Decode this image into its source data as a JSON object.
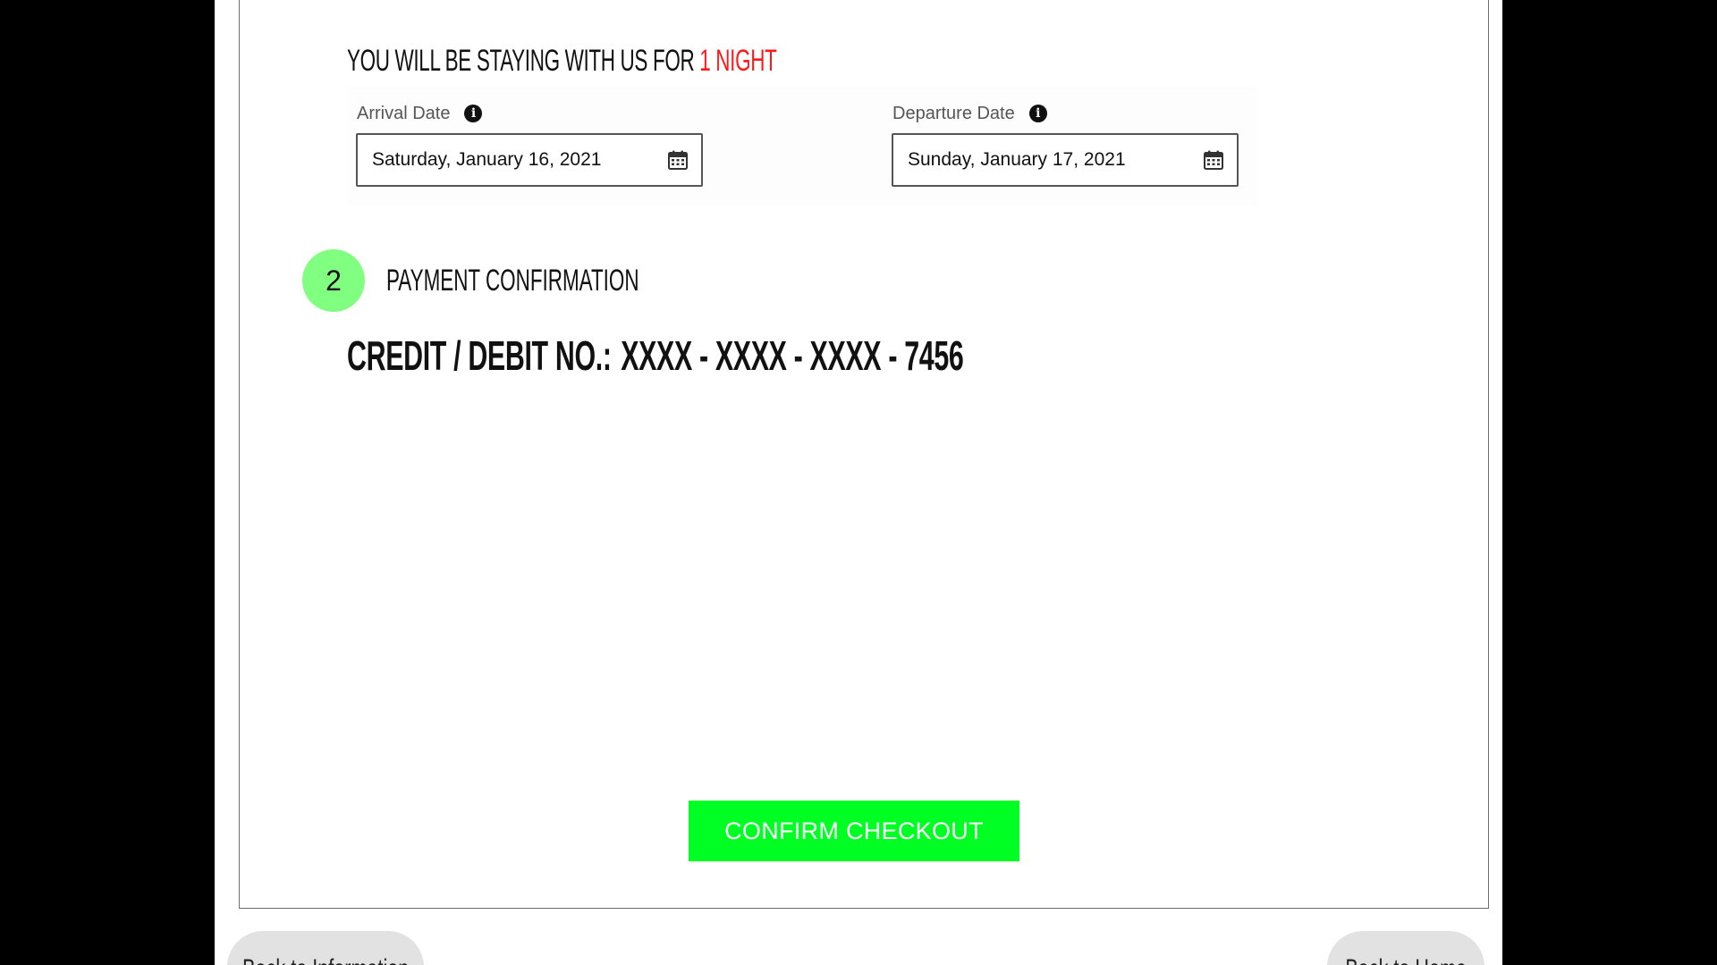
{
  "stay": {
    "prefix": "YOU WILL BE STAYING WITH US FOR",
    "nights": "1 NIGHT",
    "nights_color": "#ff1a1a"
  },
  "dates": {
    "arrival": {
      "label": "Arrival Date",
      "value": "Saturday, January 16, 2021",
      "info_icon": "info-icon",
      "calendar_icon": "calendar-icon"
    },
    "departure": {
      "label": "Departure Date",
      "value": "Sunday, January 17, 2021",
      "info_icon": "info-icon",
      "calendar_icon": "calendar-icon"
    }
  },
  "payment": {
    "step_number": "2",
    "step_color": "#80ff80",
    "title": "PAYMENT CONFIRMATION",
    "card_label": "CREDIT / DEBIT NO.:",
    "card_number": "XXXX - XXXX - XXXX - 7456"
  },
  "actions": {
    "confirm_label": "CONFIRM CHECKOUT",
    "confirm_color": "#00ff22",
    "back_info_label": "Back to Information",
    "back_home_label": "Back to Home"
  }
}
